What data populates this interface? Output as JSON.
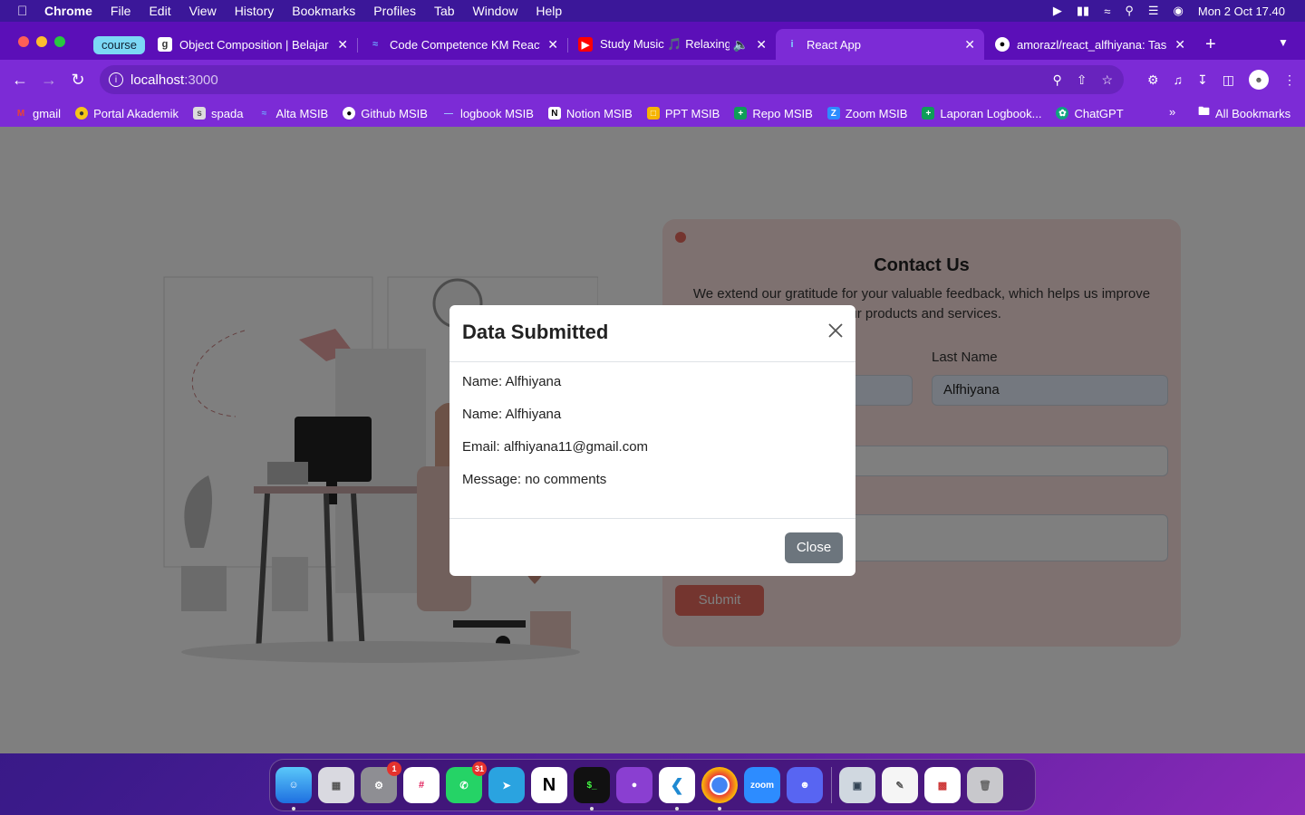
{
  "menubar": {
    "app": "Chrome",
    "items": [
      "File",
      "Edit",
      "View",
      "History",
      "Bookmarks",
      "Profiles",
      "Tab",
      "Window",
      "Help"
    ],
    "datetime": "Mon 2 Oct  17.40"
  },
  "tabs": {
    "group_label": "course",
    "list": [
      {
        "title": "Object Composition | Belajar",
        "close": "✕"
      },
      {
        "title": "Code Competence KM React",
        "close": "✕"
      },
      {
        "title": "Study Music 🎵 Relaxing",
        "close": "✕"
      },
      {
        "title": "React App",
        "close": "✕"
      },
      {
        "title": "amorazl/react_alfhiyana: Tas",
        "close": "✕"
      }
    ],
    "new_tab": "+"
  },
  "toolbar": {
    "url_host": "localhost",
    "url_port": ":3000"
  },
  "bookmarks": {
    "items": [
      "gmail",
      "Portal Akademik",
      "spada",
      "Alta MSIB",
      "Github MSIB",
      "logbook MSIB",
      "Notion MSIB",
      "PPT MSIB",
      "Repo MSIB",
      "Zoom MSIB",
      "Laporan Logbook...",
      "ChatGPT"
    ],
    "more": "»",
    "all": "All Bookmarks"
  },
  "contact": {
    "title": "Contact Us",
    "subtitle": "We extend our gratitude for your valuable feedback, which helps us improve our products and services.",
    "last_name_label": "Last Name",
    "last_name_value": "Alfhiyana",
    "submit": "Submit"
  },
  "modal": {
    "title": "Data Submitted",
    "lines": [
      "Name: Alfhiyana",
      "Name: Alfhiyana",
      "Email: alfhiyana11@gmail.com",
      "Message: no comments"
    ],
    "close": "Close"
  },
  "dock": {
    "items": [
      "Finder",
      "Launchpad",
      "System Settings",
      "Slack",
      "WhatsApp",
      "Telegram",
      "Notion",
      "Terminal",
      "GitHub Desktop",
      "VS Code",
      "Chrome",
      "Zoom",
      "Discord",
      "Preview",
      "TextEdit",
      "Photo Booth",
      "Trash"
    ],
    "badge_settings": "1",
    "badge_whatsapp": "31",
    "zoom_label": "zoom"
  }
}
